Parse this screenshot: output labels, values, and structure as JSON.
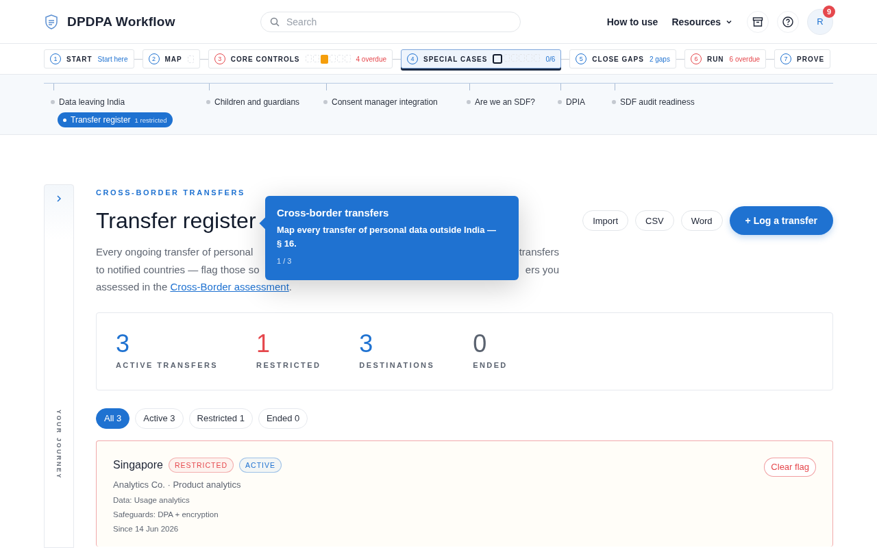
{
  "app": {
    "title": "DPDPA Workflow"
  },
  "search": {
    "placeholder": "Search"
  },
  "nav": [
    {
      "label": "How to use",
      "kind": "link"
    },
    {
      "label": "Resources",
      "kind": "menu"
    }
  ],
  "account": {
    "initial": "R",
    "badge": "9"
  },
  "steps": [
    {
      "number": "1",
      "label": "START",
      "extra": "Start here",
      "color": "#1f72d1",
      "selected": false
    },
    {
      "number": "2",
      "label": "MAP",
      "color": "#1f72d1",
      "selected": false,
      "segments": [
        {
          "filled": false,
          "current": false
        }
      ]
    },
    {
      "number": "3",
      "label": "CORE CONTROLS",
      "extra": "4 overdue",
      "color": "#e5484d",
      "selected": false,
      "segments": [
        {
          "filled": false,
          "current": false
        },
        {
          "filled": false,
          "current": false
        },
        {
          "filled": true,
          "current": false
        },
        {
          "filled": false,
          "current": false
        },
        {
          "filled": false,
          "current": false
        },
        {
          "filled": false,
          "current": false
        }
      ]
    },
    {
      "number": "4",
      "label": "SPECIAL CASES",
      "extra": "0/6",
      "color": "#1f72d1",
      "selected": true,
      "segments": [
        {
          "filled": false,
          "current": true
        },
        {
          "filled": false,
          "current": false
        },
        {
          "filled": false,
          "current": false
        },
        {
          "filled": false,
          "current": false
        },
        {
          "filled": false,
          "current": false
        },
        {
          "filled": false,
          "current": false
        }
      ]
    },
    {
      "number": "5",
      "label": "CLOSE GAPS",
      "extra": "2 gaps",
      "color": "#1f72d1",
      "selected": false
    },
    {
      "number": "6",
      "label": "RUN",
      "extra": "6 overdue",
      "color": "#e5484d",
      "selected": false
    },
    {
      "number": "7",
      "label": "PROVE",
      "color": "#1f72d1",
      "selected": false
    }
  ],
  "substeps": [
    {
      "label": "Data leaving India",
      "children": [
        {
          "label": "Transfer register",
          "badge": "1 restricted",
          "selected": true
        }
      ]
    },
    {
      "label": "Children and guardians"
    },
    {
      "label": "Consent manager integration"
    },
    {
      "label": "Are we an SDF?"
    },
    {
      "label": "DPIA"
    },
    {
      "label": "SDF audit readiness"
    }
  ],
  "rail": {
    "label": "YOUR JOURNEY"
  },
  "page": {
    "eyebrow": "CROSS-BORDER TRANSFERS",
    "title": "Transfer register",
    "description_lines": [
      {
        "left": "Every ongoing transfer of personal",
        "right": "transfers"
      },
      {
        "left": "to notified countries — flag those so",
        "right": "ers you"
      }
    ],
    "description_last": {
      "before": "assessed in the ",
      "link": "Cross-Border assessment",
      "after": "."
    },
    "actions": [
      {
        "label": "Import",
        "kind": "outline"
      },
      {
        "label": "CSV",
        "kind": "outline"
      },
      {
        "label": "Word",
        "kind": "outline"
      },
      {
        "label": "+ Log a transfer",
        "kind": "primary"
      }
    ]
  },
  "tooltip": {
    "title": "Cross-border transfers",
    "body": "Map every transfer of personal data outside India — § 16.",
    "counter": "1 / 3"
  },
  "stats": [
    {
      "value": "3",
      "label": "ACTIVE TRANSFERS",
      "color": "#1f72d1"
    },
    {
      "value": "1",
      "label": "RESTRICTED",
      "color": "#e5484d"
    },
    {
      "value": "3",
      "label": "DESTINATIONS",
      "color": "#1f72d1"
    },
    {
      "value": "0",
      "label": "ENDED",
      "color": "#5b6370"
    }
  ],
  "filters": [
    {
      "label": "All 3",
      "selected": true
    },
    {
      "label": "Active 3",
      "selected": false
    },
    {
      "label": "Restricted 1",
      "selected": false
    },
    {
      "label": "Ended 0",
      "selected": false
    }
  ],
  "transfers": [
    {
      "country": "Singapore",
      "restricted": true,
      "tags": [
        {
          "label": "RESTRICTED",
          "color": "#e5484d"
        },
        {
          "label": "ACTIVE",
          "color": "#1f72d1"
        }
      ],
      "vendor": "Analytics Co. · Product analytics",
      "details": [
        "Data: Usage analytics",
        "Safeguards: DPA + encryption",
        "Since 14 Jun 2026"
      ],
      "action": "Clear flag"
    }
  ]
}
